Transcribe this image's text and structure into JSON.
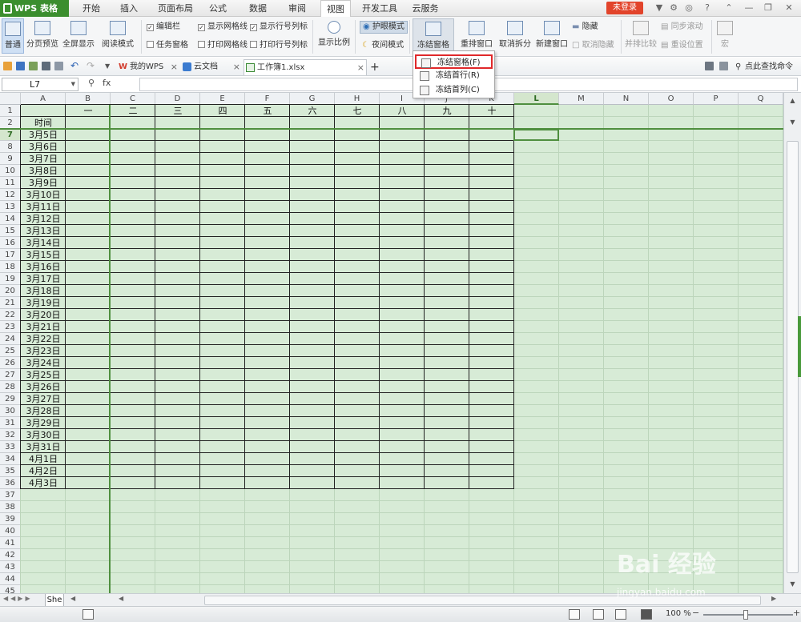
{
  "app": {
    "logo": "WPS 表格"
  },
  "menu": {
    "tabs": [
      "开始",
      "插入",
      "页面布局",
      "公式",
      "数据",
      "审阅",
      "视图",
      "开发工具",
      "云服务"
    ],
    "active": "视图",
    "login": "未登录"
  },
  "ribbon": {
    "normal": "普通",
    "page_preview": "分页预览",
    "fullscreen": "全屏显示",
    "reading_mode": "阅读模式",
    "edit_bar": "编辑栏",
    "task_pane": "任务窗格",
    "show_gridlines": "显示网格线",
    "print_gridlines": "打印网格线",
    "show_headers": "显示行号列标",
    "print_headers": "打印行号列标",
    "zoom": "显示比例",
    "eye_mode": "护眼模式",
    "night_mode": "夜间模式",
    "freeze": "冻结窗格",
    "arrange": "重排窗口",
    "unsplit": "取消拆分",
    "new_window": "新建窗口",
    "hide": "隐藏",
    "unhide": "取消隐藏",
    "side_by_side": "并排比较",
    "sync_scroll": "同步滚动",
    "reset_pos": "重设位置",
    "macro": "宏"
  },
  "freeze_menu": {
    "items": [
      "冻结窗格(F)",
      "冻结首行(R)",
      "冻结首列(C)"
    ]
  },
  "doc_tabs": {
    "tabs": [
      "我的WPS",
      "云文档",
      "工作簿1.xlsx"
    ],
    "search": "点此查找命令"
  },
  "formula_bar": {
    "name_box": "L7",
    "fx": "fx",
    "value": ""
  },
  "grid": {
    "columns": [
      "A",
      "B",
      "C",
      "D",
      "E",
      "F",
      "G",
      "H",
      "I",
      "J",
      "K",
      "L",
      "M",
      "N",
      "O",
      "P",
      "Q"
    ],
    "rows": [
      "1",
      "2",
      "7",
      "8",
      "9",
      "10",
      "11",
      "12",
      "13",
      "14",
      "15",
      "16",
      "17",
      "18",
      "19",
      "20",
      "21",
      "22",
      "23",
      "24",
      "25",
      "26",
      "27",
      "28",
      "29",
      "30",
      "31",
      "32",
      "33",
      "34",
      "35",
      "36",
      "37",
      "38",
      "39",
      "40",
      "41",
      "42",
      "43",
      "44",
      "45"
    ],
    "header_row": [
      "一",
      "二",
      "三",
      "四",
      "五",
      "六",
      "七",
      "八",
      "九",
      "十"
    ],
    "time_label": "时间",
    "dates": [
      "3月5日",
      "3月6日",
      "3月7日",
      "3月8日",
      "3月9日",
      "3月10日",
      "3月11日",
      "3月12日",
      "3月13日",
      "3月14日",
      "3月15日",
      "3月16日",
      "3月17日",
      "3月18日",
      "3月19日",
      "3月20日",
      "3月21日",
      "3月22日",
      "3月23日",
      "3月24日",
      "3月25日",
      "3月26日",
      "3月27日",
      "3月28日",
      "3月29日",
      "3月30日",
      "3月31日",
      "4月1日",
      "4月2日",
      "4月3日"
    ]
  },
  "sheet": {
    "tab": "She"
  },
  "status": {
    "zoom": "100 %"
  },
  "watermark": {
    "text": "Bai 经验",
    "url": "jingyan.baidu.com"
  }
}
